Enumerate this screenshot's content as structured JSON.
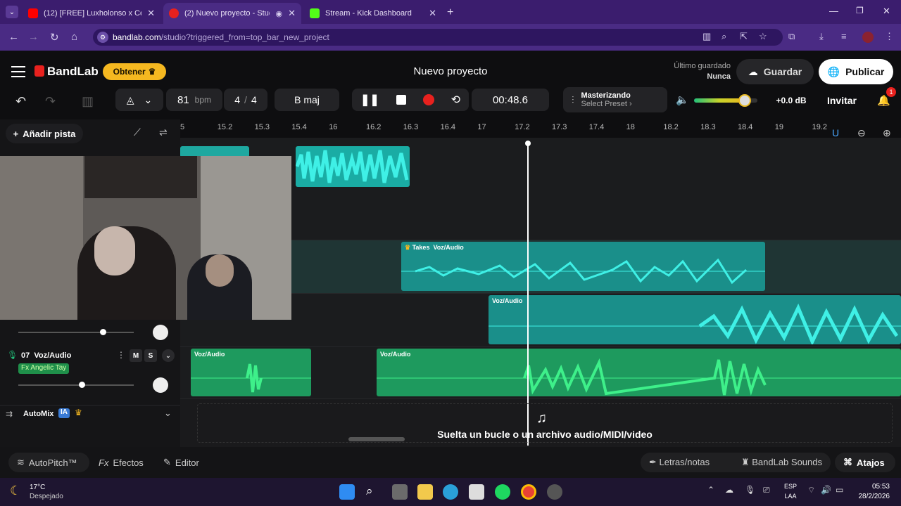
{
  "browser": {
    "tabs": [
      {
        "label": "(12) [FREE] Luxholonso x Cero°",
        "active": false
      },
      {
        "label": "(2) Nuevo proyecto - Studio",
        "active": true
      },
      {
        "label": "Stream - Kick Dashboard",
        "active": false
      }
    ],
    "url_domain": "bandlab.com",
    "url_path": "/studio?triggered_from=top_bar_new_project"
  },
  "app": {
    "brand": "BandLab",
    "obtener": "Obtener",
    "project_title": "Nuevo proyecto",
    "last_saved_label": "Último guardado",
    "last_saved_value": "Nunca",
    "save": "Guardar",
    "publish": "Publicar",
    "invite": "Invitar",
    "notifications": "1"
  },
  "transport": {
    "bpm": "81",
    "bpm_unit": "bpm",
    "time_sig_num": "4",
    "time_sig_sep": "/",
    "time_sig_den": "4",
    "key": "B maj",
    "time": "00:48.6",
    "mastering_title": "Masterizando",
    "mastering_preset": "Select Preset",
    "master_volume_db": "+0.0 dB",
    "master_volume_level": 0.8
  },
  "toolbar": {
    "add_track": "Añadir pista"
  },
  "ruler": [
    "5",
    "15.2",
    "15.3",
    "15.4",
    "16",
    "16.2",
    "16.3",
    "16.4",
    "17",
    "17.2",
    "17.3",
    "17.4",
    "18",
    "18.2",
    "18.3",
    "18.4",
    "19",
    "19.2"
  ],
  "tracks": {
    "t07": {
      "number": "07",
      "name": "Voz/Audio",
      "fx": "Fx Angelic Tay",
      "mute": "M",
      "solo": "S",
      "volume": 0.55
    },
    "upper_volume": 0.73,
    "automix": "AutoMix",
    "automix_badge": "IA"
  },
  "clips": {
    "takes_label": "Takes",
    "takes_name": "Voz/Audio",
    "c2": "Voz/Audio",
    "c3": "Voz/Audio",
    "c4": "Voz/Audio"
  },
  "dropzone": "Suelta un bucle o un archivo audio/MIDI/video",
  "bottom": {
    "autopitch": "AutoPitch™",
    "effects": "Efectos",
    "editor": "Editor",
    "lyrics": "Letras/notas",
    "sounds": "BandLab Sounds",
    "shortcuts": "Atajos"
  },
  "taskbar": {
    "temp": "17°C",
    "weather": "Despejado",
    "lang1": "ESP",
    "lang2": "LAA",
    "clock": "05:53",
    "date": "28/2/2026"
  },
  "colors": {
    "accent": "#f5b820",
    "teal": "#1ec8c0",
    "green": "#22c07a",
    "record": "#e8211e"
  }
}
